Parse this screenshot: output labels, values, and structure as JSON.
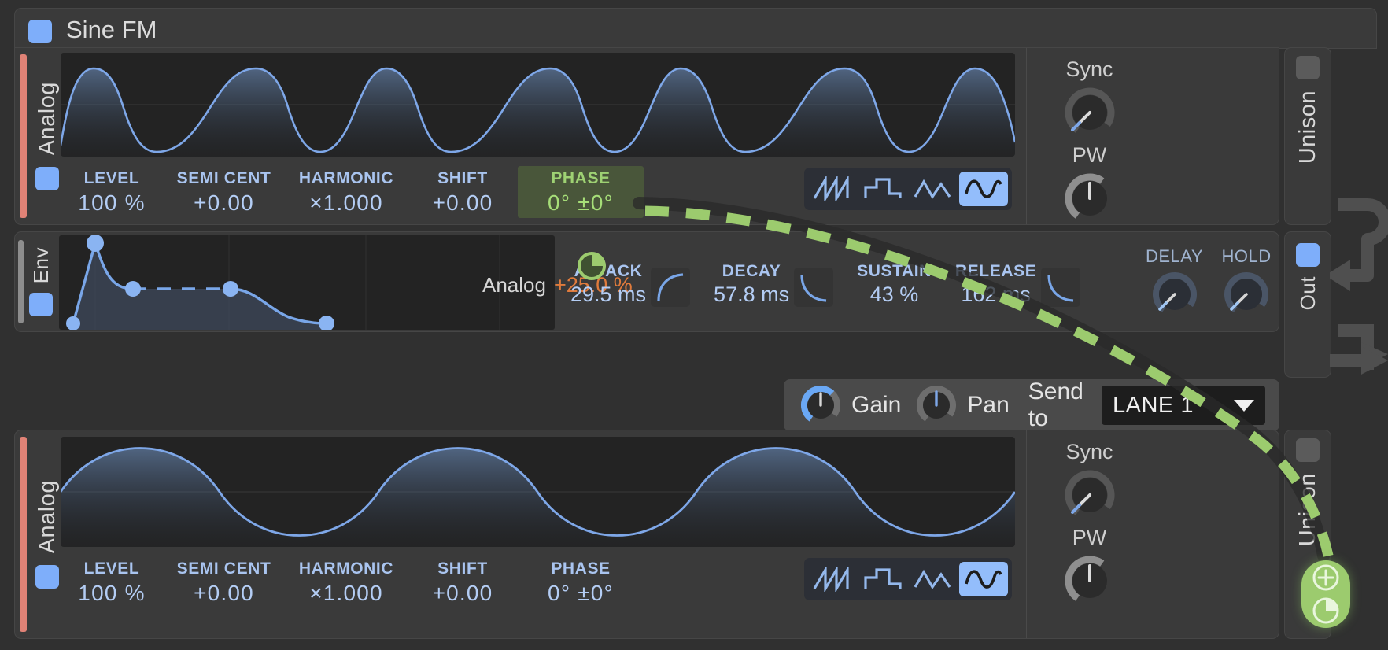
{
  "window": {
    "title": "Sine FM",
    "title_toggle_color": "#7eaefa",
    "background": "#303030"
  },
  "colors": {
    "accent_blue": "#7eaefa",
    "param_label": "#a9c4ef",
    "param_value": "#b4cdf4",
    "highlight_green": "#9ed173",
    "highlight_bg": "#49563a",
    "analog_orange": "#e07b3c",
    "osc_stripe": "#e08276",
    "env_stripe": "#8d8d8d",
    "drag_badge": "#9ccb6e"
  },
  "oscillator_1": {
    "rail_label": "Analog",
    "enabled_chip": true,
    "waveform_selected": "sine",
    "waveforms": [
      {
        "name": "saw-wave",
        "label": "Saw",
        "selected": false
      },
      {
        "name": "square-wave",
        "label": "Square",
        "selected": false
      },
      {
        "name": "triangle-wave",
        "label": "Triangle",
        "selected": false
      },
      {
        "name": "sine-wave",
        "label": "Sine",
        "selected": true
      }
    ],
    "params": [
      {
        "label": "LEVEL",
        "value": "100 %",
        "highlighted": false
      },
      {
        "label": "SEMI CENT",
        "value": "+0.00",
        "highlighted": false
      },
      {
        "label": "HARMONIC",
        "value": "×1.000",
        "highlighted": false
      },
      {
        "label": "SHIFT",
        "value": "+0.00",
        "highlighted": false
      },
      {
        "label": "PHASE",
        "value": "0° ±0°",
        "highlighted": true
      }
    ],
    "right_column": {
      "sync_label": "Sync",
      "pw_label": "PW",
      "sync_value_pct": 0,
      "pw_value_pct": 50
    },
    "unison_label": "Unison",
    "unison_enabled": false
  },
  "envelope": {
    "rail_label": "Env",
    "enabled_chip": true,
    "mode_label": "Analog",
    "mode_value": "+25.0 %",
    "stages": [
      {
        "label": "ATTACK",
        "value": "29.5 ms",
        "curve": "attack-curve"
      },
      {
        "label": "DECAY",
        "value": "57.8 ms",
        "curve": "decay-curve"
      },
      {
        "label": "SUSTAIN",
        "value": "43 %",
        "curve": null
      },
      {
        "label": "RELEASE",
        "value": "162 ms",
        "curve": "release-curve"
      }
    ],
    "knobs": [
      {
        "label": "DELAY",
        "value_pct": 0
      },
      {
        "label": "HOLD",
        "value_pct": 0
      }
    ],
    "graph": {
      "attack_x_pct": 6,
      "peak_y_pct": 8,
      "decay_x_pct": 18,
      "sustain_level_pct": 43,
      "release_start_x_pct": 44,
      "release_end_x_pct": 64
    }
  },
  "output_bar": {
    "gain_label": "Gain",
    "pan_label": "Pan",
    "gain_value_pct": 70,
    "pan_value_pct": 50,
    "send_label": "Send to",
    "lane_value": "LANE 1"
  },
  "out_rail": {
    "label": "Out",
    "enabled_chip": true
  },
  "oscillator_2": {
    "rail_label": "Analog",
    "enabled_chip": true,
    "waveform_selected": "sine",
    "waveforms": [
      {
        "name": "saw-wave",
        "label": "Saw",
        "selected": false
      },
      {
        "name": "square-wave",
        "label": "Square",
        "selected": false
      },
      {
        "name": "triangle-wave",
        "label": "Triangle",
        "selected": false
      },
      {
        "name": "sine-wave",
        "label": "Sine",
        "selected": true
      }
    ],
    "params": [
      {
        "label": "LEVEL",
        "value": "100 %",
        "highlighted": false
      },
      {
        "label": "SEMI CENT",
        "value": "+0.00",
        "highlighted": false
      },
      {
        "label": "HARMONIC",
        "value": "×1.000",
        "highlighted": false
      },
      {
        "label": "SHIFT",
        "value": "+0.00",
        "highlighted": false
      },
      {
        "label": "PHASE",
        "value": "0° ±0°",
        "highlighted": false
      }
    ],
    "right_column": {
      "sync_label": "Sync",
      "pw_label": "PW",
      "sync_value_pct": 0,
      "pw_value_pct": 50
    },
    "unison_label": "Unison",
    "unison_enabled": false
  },
  "drag_overlay": {
    "source_name": "phase-modulation-handle",
    "target_name": "drag-drop-badge",
    "icons": [
      "plus-icon",
      "phase-pie-icon"
    ]
  }
}
